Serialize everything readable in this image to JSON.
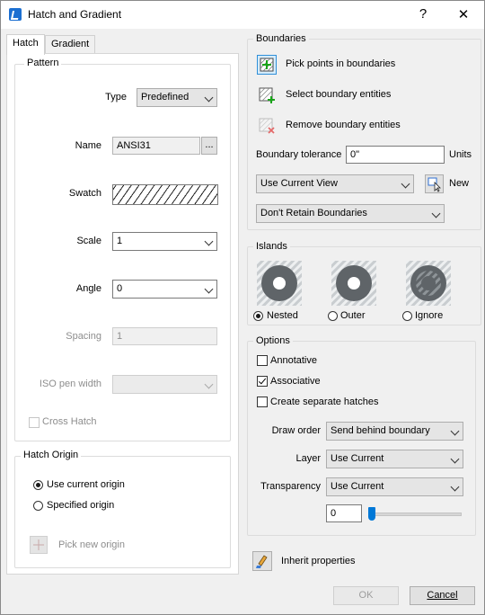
{
  "window": {
    "title": "Hatch and Gradient",
    "help": "?",
    "close": "✕"
  },
  "tabs": [
    {
      "label": "Hatch"
    },
    {
      "label": "Gradient"
    }
  ],
  "pattern": {
    "group_label": "Pattern",
    "type_label": "Type",
    "type_value": "Predefined",
    "name_label": "Name",
    "name_value": "ANSI31",
    "browse_label": "...",
    "swatch_label": "Swatch",
    "scale_label": "Scale",
    "scale_value": "1",
    "angle_label": "Angle",
    "angle_value": "0",
    "spacing_label": "Spacing",
    "spacing_value": "1",
    "iso_label": "ISO pen width",
    "iso_value": "",
    "cross_hatch_label": "Cross Hatch"
  },
  "origin": {
    "group_label": "Hatch Origin",
    "use_current": "Use current origin",
    "specified": "Specified origin",
    "pick_new": "Pick new origin"
  },
  "boundaries": {
    "group_label": "Boundaries",
    "pick_points": "Pick points in boundaries",
    "select_entities": "Select boundary entities",
    "remove_entities": "Remove boundary entities",
    "tolerance_label": "Boundary tolerance",
    "tolerance_value": "0\"",
    "units_label": "Units",
    "view_value": "Use Current View",
    "new_label": "New",
    "retain_value": "Don't Retain Boundaries"
  },
  "islands": {
    "group_label": "Islands",
    "nested": "Nested",
    "outer": "Outer",
    "ignore": "Ignore"
  },
  "options": {
    "group_label": "Options",
    "annotative": "Annotative",
    "associative": "Associative",
    "separate": "Create separate hatches",
    "draw_order_label": "Draw order",
    "draw_order_value": "Send behind boundary",
    "layer_label": "Layer",
    "layer_value": "Use Current",
    "transparency_label": "Transparency",
    "transparency_value": "Use Current",
    "transparency_amount": "0",
    "transparency_slider_level": 0
  },
  "inherit_label": "Inherit properties",
  "footer": {
    "ok": "OK",
    "cancel": "Cancel"
  },
  "colors": {
    "accent": "#0078d7",
    "island_gray": "#5f6468",
    "island_hatch": "#b9bec2"
  }
}
